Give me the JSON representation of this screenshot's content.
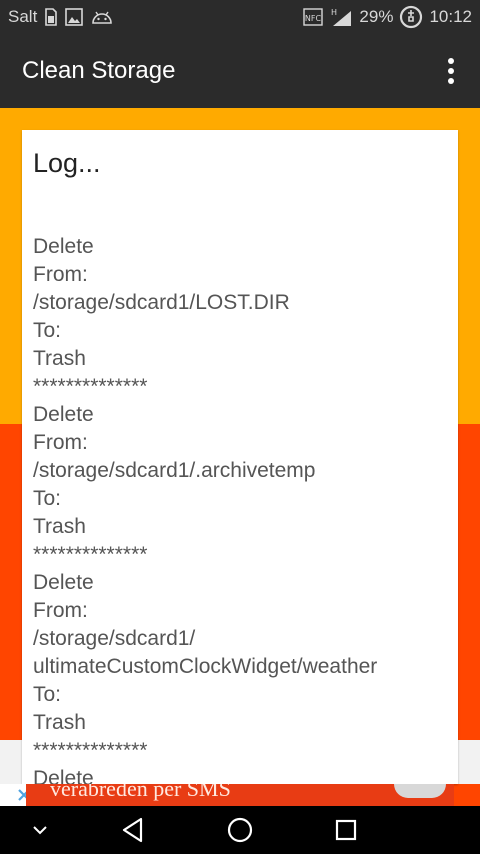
{
  "status_bar": {
    "carrier": "Salt",
    "battery": "29%",
    "time": "10:12",
    "icons": [
      "sim-icon",
      "image-icon",
      "android-icon",
      "nfc-icon",
      "signal-icon",
      "battery-charging-icon"
    ]
  },
  "app_bar": {
    "title": "Clean Storage",
    "menu_icon": "overflow-menu-icon"
  },
  "log": {
    "title": "Log...",
    "lines": [
      "Delete",
      "From:",
      "/storage/sdcard1/LOST.DIR",
      "To:",
      "Trash",
      "**************",
      "Delete",
      "From:",
      "/storage/sdcard1/.archivetemp",
      "To:",
      "Trash",
      "**************",
      "Delete",
      "From:",
      "/storage/sdcard1/",
      "ultimateCustomClockWidget/weather",
      "To:",
      "Trash",
      "**************",
      "Delete"
    ]
  },
  "ad": {
    "text": "verabreden per SMS",
    "close_icon": "close-icon"
  },
  "nav_bar": {
    "icons": [
      "chevron-down-icon",
      "back-icon",
      "home-icon",
      "recents-icon"
    ]
  },
  "colors": {
    "bar": "#2b2b2b",
    "yellow": "#ffaa00",
    "orange": "#ff4500",
    "card": "#ffffff",
    "ad_close": "#4fa3e0"
  }
}
